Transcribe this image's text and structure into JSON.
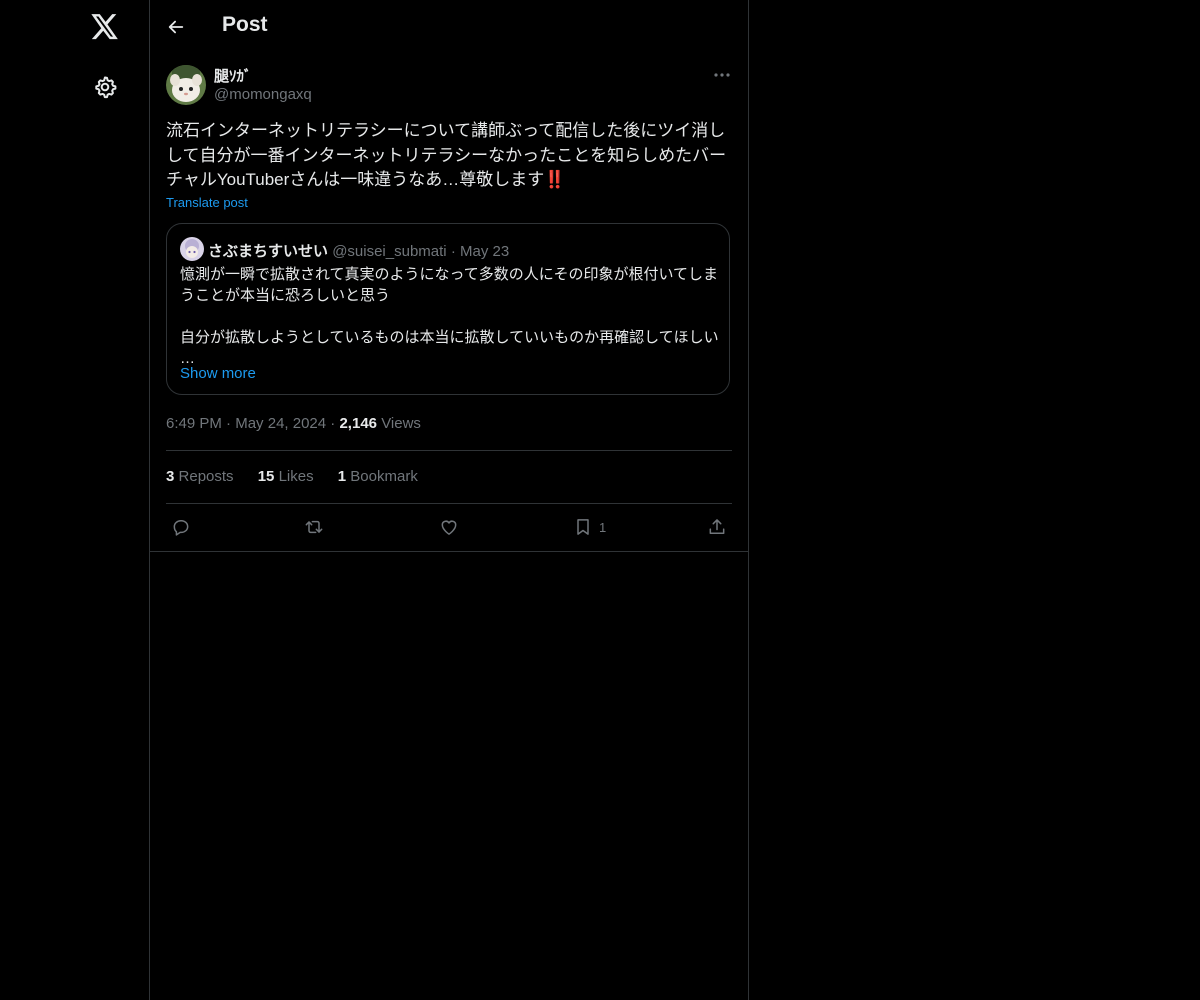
{
  "nav": {
    "logo_icon": "x-logo-icon",
    "settings_icon": "gear-icon"
  },
  "header": {
    "title": "Post",
    "back_icon": "arrow-left-icon"
  },
  "post": {
    "author_name": "腿ｿｶﾞ",
    "author_handle": "@momongaxq",
    "text": "流石インターネットリテラシーについて講師ぶって配信した後にツイ消しして自分が一番インターネットリテラシーなかったことを知らしめたバーチャルYouTuberさんは一味違うなあ…尊敬します",
    "emoji": "‼️",
    "translate_label": "Translate post",
    "time": "6:49 PM",
    "date": "May 24, 2024",
    "views_count": "2,146",
    "views_label": "Views"
  },
  "quote": {
    "author_name": "さぶまちすいせい",
    "author_handle": "@suisei_submati",
    "date": "May 23",
    "text": "憶測が一瞬で拡散されて真実のようになって多数の人にその印象が根付いてしまうことが本当に恐ろしいと思う\n\n自分が拡散しようとしているものは本当に拡散していいものか再確認してほしい\n…",
    "show_more": "Show more"
  },
  "stats": {
    "reposts_count": "3",
    "reposts_label": "Reposts",
    "likes_count": "15",
    "likes_label": "Likes",
    "bookmarks_count": "1",
    "bookmarks_label": "Bookmark"
  },
  "actions": {
    "bookmark_count": "1"
  },
  "colors": {
    "background": "#000000",
    "text": "#e7e9ea",
    "muted": "#71767b",
    "accent": "#1d9bf0",
    "border": "#2f3336",
    "emoji_red": "#e0245e"
  }
}
